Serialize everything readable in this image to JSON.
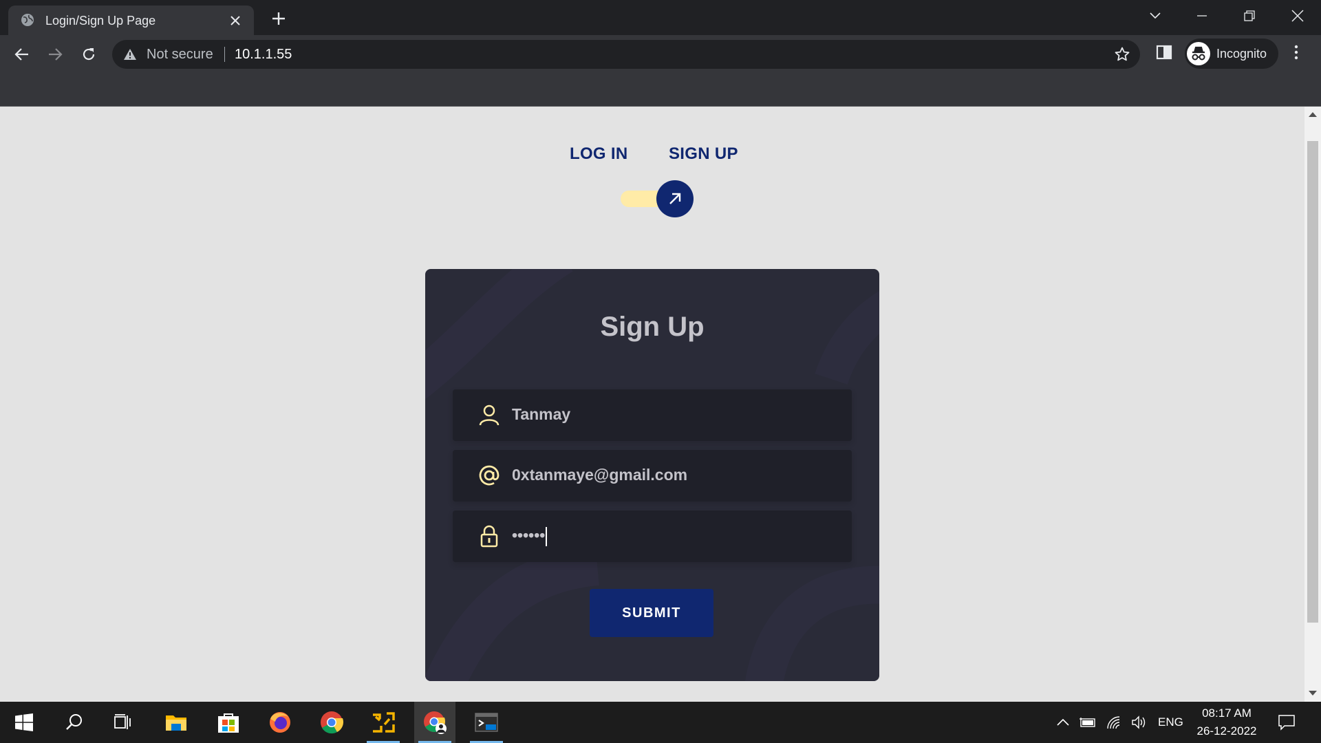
{
  "browser": {
    "tab": {
      "title": "Login/Sign Up Page"
    },
    "omnibox": {
      "security_label": "Not secure",
      "url": "10.1.1.55"
    },
    "profile": {
      "label": "Incognito"
    }
  },
  "page": {
    "mode_tabs": [
      "LOG IN",
      "SIGN UP"
    ],
    "toggle_state": "sign-up",
    "card": {
      "title": "Sign Up",
      "fields": [
        {
          "icon": "user-icon",
          "value": "Tanmay"
        },
        {
          "icon": "at-sign-icon",
          "value": "0xtanmaye@gmail.com"
        },
        {
          "icon": "lock-icon",
          "value": "••••••"
        }
      ],
      "submit_label": "SUBMIT"
    }
  },
  "taskbar": {
    "apps": [
      "start-icon",
      "search-icon",
      "task-view-icon",
      "file-explorer-icon",
      "microsoft-store-icon",
      "firefox-icon",
      "chrome-icon",
      "vmware-icon",
      "chrome-incognito-icon",
      "terminal-icon"
    ],
    "tray": {
      "language": "ENG",
      "time": "08:17 AM",
      "date": "26-12-2022"
    }
  },
  "colors": {
    "accent_navy": "#102770",
    "accent_yellow": "#ffeba7",
    "card_bg": "#2a2b38",
    "field_bg": "#1f2029"
  }
}
